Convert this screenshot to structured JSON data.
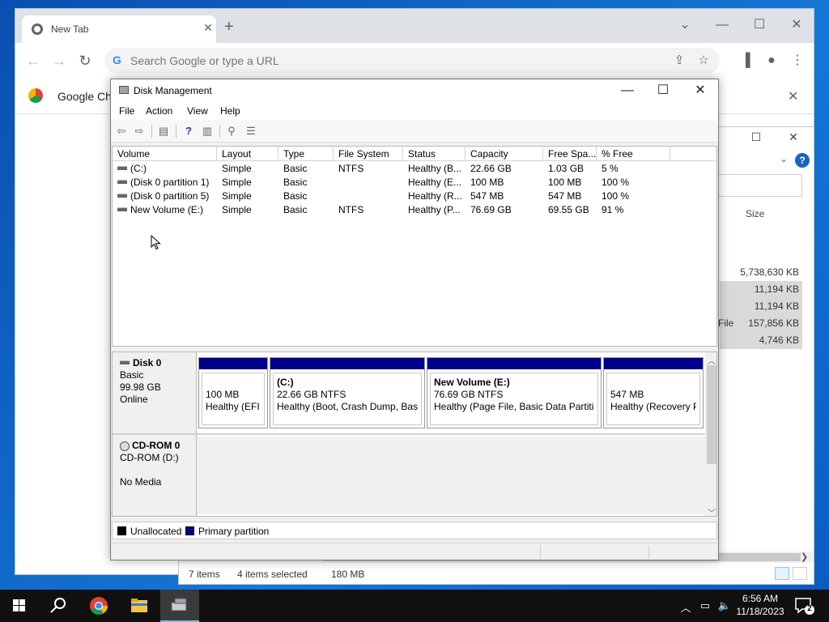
{
  "chrome": {
    "tab_title": "New Tab",
    "tab_close": "✕",
    "new_tab": "+",
    "omnibox_placeholder": "Search Google or type a URL",
    "infobar_text": "Google Chr"
  },
  "explorer": {
    "column_size": "Size",
    "sizes": [
      "5,738,630 KB",
      "11,194 KB",
      "11,194 KB",
      "157,856 KB",
      "4,746 KB"
    ],
    "type_partial": "File",
    "status_items": "7 items",
    "status_selected": "4 items selected",
    "status_size": "180 MB"
  },
  "disk_management": {
    "title": "Disk Management",
    "menu": [
      "File",
      "Action",
      "View",
      "Help"
    ],
    "columns": [
      "Volume",
      "Layout",
      "Type",
      "File System",
      "Status",
      "Capacity",
      "Free Spa...",
      "% Free"
    ],
    "rows": [
      {
        "volume": "(C:)",
        "layout": "Simple",
        "type": "Basic",
        "fs": "NTFS",
        "status": "Healthy (B...",
        "capacity": "22.66 GB",
        "free": "1.03 GB",
        "pct": "5 %"
      },
      {
        "volume": "(Disk 0 partition 1)",
        "layout": "Simple",
        "type": "Basic",
        "fs": "",
        "status": "Healthy (E...",
        "capacity": "100 MB",
        "free": "100 MB",
        "pct": "100 %"
      },
      {
        "volume": "(Disk 0 partition 5)",
        "layout": "Simple",
        "type": "Basic",
        "fs": "",
        "status": "Healthy (R...",
        "capacity": "547 MB",
        "free": "547 MB",
        "pct": "100 %"
      },
      {
        "volume": "New Volume (E:)",
        "layout": "Simple",
        "type": "Basic",
        "fs": "NTFS",
        "status": "Healthy (P...",
        "capacity": "76.69 GB",
        "free": "69.55 GB",
        "pct": "91 %"
      }
    ],
    "disk0": {
      "name": "Disk 0",
      "type": "Basic",
      "size": "99.98 GB",
      "state": "Online",
      "partitions": [
        {
          "name": "",
          "size": "100 MB",
          "status": "Healthy (EFI System Partition)"
        },
        {
          "name": "(C:)",
          "size": "22.66 GB NTFS",
          "status": "Healthy (Boot, Crash Dump, Basic Data Partition)"
        },
        {
          "name": "New Volume  (E:)",
          "size": "76.69 GB NTFS",
          "status": "Healthy (Page File, Basic Data Partition)"
        },
        {
          "name": "",
          "size": "547 MB",
          "status": "Healthy (Recovery Partition)"
        }
      ]
    },
    "cdrom": {
      "name": "CD-ROM 0",
      "drive": "CD-ROM (D:)",
      "media": "No Media"
    },
    "legend": {
      "unallocated": "Unallocated",
      "primary": "Primary partition",
      "unallocated_color": "#000000",
      "primary_color": "#00008b"
    }
  },
  "taskbar": {
    "time": "6:56 AM",
    "date": "11/18/2023",
    "notification_count": "2"
  }
}
